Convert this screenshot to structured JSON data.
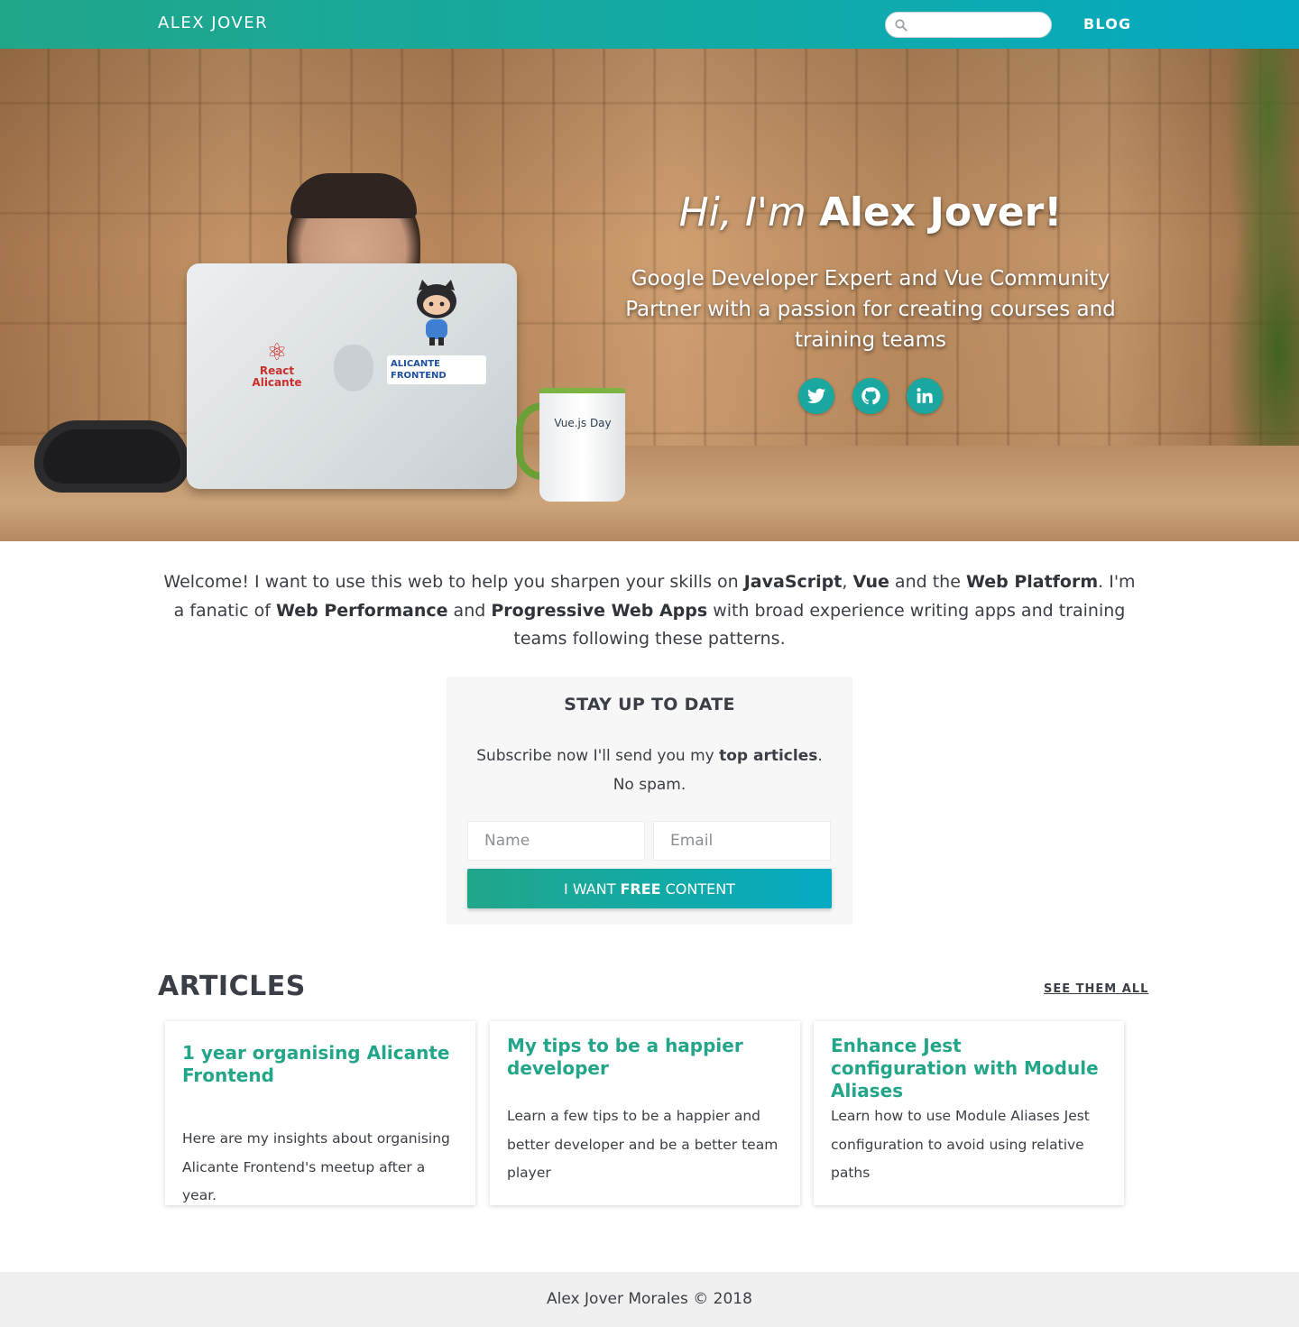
{
  "nav": {
    "brand": "ALEX JOVER",
    "search_placeholder": "",
    "blog_label": "BLOG"
  },
  "hero": {
    "greeting": "Hi, I'm",
    "name": "Alex Jover!",
    "subtitle": "Google Developer Expert and Vue Community Partner with a passion for creating courses and training teams",
    "social": [
      "twitter-icon",
      "github-icon",
      "linkedin-icon"
    ],
    "photo": {
      "react_sticker_line1": "React",
      "react_sticker_line2": "Alicante",
      "alicante_sticker_line1": "ALICANTE",
      "alicante_sticker_line2": "FRONTEND",
      "mug_label": "Vue.js Day"
    }
  },
  "intro": {
    "p1": "Welcome! I want to use this web to help you sharpen your skills on ",
    "b1": "JavaScript",
    "p2": ", ",
    "b2": "Vue",
    "p3": " and the ",
    "b3": "Web Platform",
    "p4": ". I'm a fanatic of ",
    "b4": "Web Performance",
    "p5": " and ",
    "b5": "Progressive Web Apps",
    "p6": " with broad experience writing apps and training teams following these patterns."
  },
  "subscribe": {
    "title": "STAY UP TO DATE",
    "text_before": "Subscribe now I'll send you my ",
    "text_bold": "top articles",
    "text_after": ". No spam.",
    "name_placeholder": "Name",
    "email_placeholder": "Email",
    "cta_before": "I WANT",
    "cta_bold": "FREE",
    "cta_after": "CONTENT"
  },
  "articles": {
    "title": "ARTICLES",
    "see_all": "SEE THEM ALL",
    "items": [
      {
        "title": "1 year organising Alicante Frontend",
        "description": "Here are my insights about organising Alicante Frontend's meetup after a year."
      },
      {
        "title": "My tips to be a happier developer",
        "description": "Learn a few tips to be a happier and better developer and be a better team player"
      },
      {
        "title": "Enhance Jest configuration with Module Aliases",
        "description": "Learn how to use Module Aliases Jest configuration to avoid using relative paths"
      }
    ]
  },
  "footer": {
    "text": "Alex Jover Morales © 2018"
  },
  "colors": {
    "accent_start": "#21a68a",
    "accent_end": "#04a9c2",
    "link": "#22a589",
    "text": "#3a3f47"
  }
}
